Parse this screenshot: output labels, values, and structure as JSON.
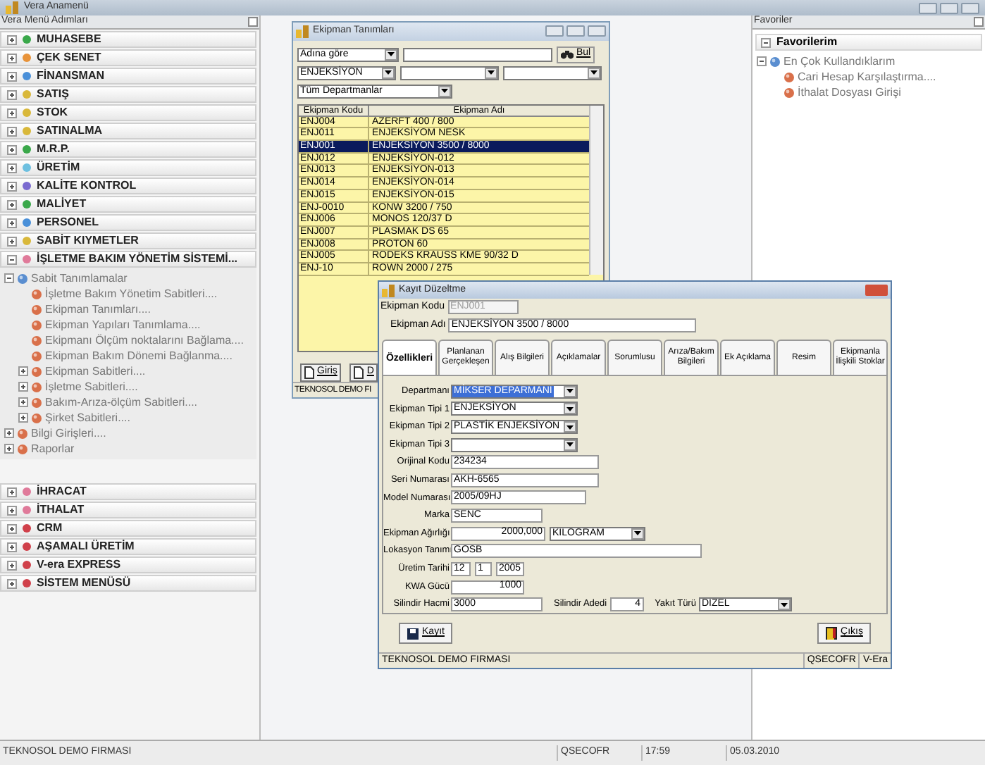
{
  "window": {
    "title": "Vera Anamenü"
  },
  "menu_panel": {
    "title": "Vera Menü Adımları",
    "items": [
      {
        "label": "MUHASEBE",
        "expanded": false,
        "color": "#3aa84a"
      },
      {
        "label": "ÇEK SENET",
        "expanded": false,
        "color": "#e8933a"
      },
      {
        "label": "FİNANSMAN",
        "expanded": false,
        "color": "#4a90d9"
      },
      {
        "label": "SATIŞ",
        "expanded": false,
        "color": "#d9b83a"
      },
      {
        "label": "STOK",
        "expanded": false,
        "color": "#d9b83a"
      },
      {
        "label": "SATINALMA",
        "expanded": false,
        "color": "#d9b83a"
      },
      {
        "label": "M.R.P.",
        "expanded": false,
        "color": "#3aa84a"
      },
      {
        "label": "ÜRETİM",
        "expanded": false,
        "color": "#6ec0e0"
      },
      {
        "label": "KALİTE KONTROL",
        "expanded": false,
        "color": "#7a6ad0"
      },
      {
        "label": "MALİYET",
        "expanded": false,
        "color": "#3aa84a"
      },
      {
        "label": "PERSONEL",
        "expanded": false,
        "color": "#4a90d9"
      },
      {
        "label": "SABİT KIYMETLER",
        "expanded": false,
        "color": "#d9b83a"
      },
      {
        "label": "İŞLETME BAKIM YÖNETİM SİSTEMİ...",
        "expanded": true,
        "color": "#e07a9a",
        "children": [
          {
            "label": "Sabit Tanımlamalar",
            "expanded": true,
            "children": [
              {
                "label": "İşletme Bakım Yönetim Sabitleri...."
              },
              {
                "label": "Ekipman Tanımları...."
              },
              {
                "label": "Ekipman Yapıları Tanımlama...."
              },
              {
                "label": "Ekipmanı Ölçüm noktalarını Bağlama...."
              },
              {
                "label": "Ekipman Bakım Dönemi Bağlanma...."
              },
              {
                "label": "Ekipman Sabitleri....",
                "expanded": false
              },
              {
                "label": "İşletme Sabitleri....",
                "expanded": false
              },
              {
                "label": "Bakım-Arıza-ölçüm Sabitleri....",
                "expanded": false
              },
              {
                "label": "Şirket Sabitleri....",
                "expanded": false
              }
            ]
          },
          {
            "label": "Bilgi Girişleri....",
            "expanded": false
          },
          {
            "label": "Raporlar",
            "expanded": false
          }
        ]
      },
      {
        "label": "İHRACAT",
        "expanded": false,
        "color": "#e07a9a"
      },
      {
        "label": "İTHALAT",
        "expanded": false,
        "color": "#e07a9a"
      },
      {
        "label": "CRM",
        "expanded": false,
        "color": "#d0404a"
      },
      {
        "label": "AŞAMALI ÜRETİM",
        "expanded": false,
        "color": "#d0404a"
      },
      {
        "label": "V-era EXPRESS",
        "expanded": false,
        "color": "#d0404a"
      },
      {
        "label": "SİSTEM MENÜSÜ",
        "expanded": false,
        "color": "#d0404a"
      }
    ]
  },
  "favorites_panel": {
    "title": "Favoriler",
    "group": "Favorilerim",
    "items": [
      {
        "label": "En Çok Kullandıklarım",
        "expanded": true,
        "children": [
          {
            "label": "Cari Hesap Karşılaştırma...."
          },
          {
            "label": "İthalat Dosyası Girişi"
          }
        ]
      }
    ]
  },
  "equipment_window": {
    "title": "Ekipman Tanımları",
    "search_by": "Adına göre",
    "search_button": "Bul",
    "type_filter": "ENJEKSİYON",
    "department": "Tüm Departmanlar",
    "columns": [
      "Ekipman Kodu",
      "Ekipman Adı"
    ],
    "rows": [
      {
        "code": "ENJ004",
        "name": "AZERFT 400 / 800",
        "selected": false
      },
      {
        "code": "ENJ011",
        "name": "ENJEKSİYOM NESK",
        "selected": false
      },
      {
        "code": "ENJ001",
        "name": "ENJEKSİYON 3500 / 8000",
        "selected": true
      },
      {
        "code": "ENJ012",
        "name": "ENJEKSİYON-012",
        "selected": false
      },
      {
        "code": "ENJ013",
        "name": "ENJEKSİYON-013",
        "selected": false
      },
      {
        "code": "ENJ014",
        "name": "ENJEKSİYON-014",
        "selected": false
      },
      {
        "code": "ENJ015",
        "name": "ENJEKSİYON-015",
        "selected": false
      },
      {
        "code": "ENJ-0010",
        "name": "KONW 3200 / 750",
        "selected": false
      },
      {
        "code": "ENJ006",
        "name": "MONOS 120/37 D",
        "selected": false
      },
      {
        "code": "ENJ007",
        "name": "PLASMAK DS 65",
        "selected": false
      },
      {
        "code": "ENJ008",
        "name": "PROTON 60",
        "selected": false
      },
      {
        "code": "ENJ005",
        "name": "RODEKS KRAUSS KME 90/32 D",
        "selected": false
      },
      {
        "code": "ENJ-10",
        "name": "ROWN 2000 / 275",
        "selected": false
      }
    ],
    "buttons": [
      "Giriş",
      "D"
    ],
    "status": "TEKNOSOL DEMO FI"
  },
  "edit_window": {
    "title": "Kayıt Düzeltme",
    "header_fields": [
      {
        "label": "Ekipman Kodu",
        "value": "ENJ001",
        "disabled": true
      },
      {
        "label": "Ekipman Adı",
        "value": "ENJEKSİYON 3500 / 8000",
        "disabled": false
      }
    ],
    "tabs": [
      {
        "label": "Özellikleri",
        "selected": true
      },
      {
        "label": "Planlanan Gerçekleşen",
        "selected": false
      },
      {
        "label": "Alış Bilgileri",
        "selected": false
      },
      {
        "label": "Açıklamalar",
        "selected": false
      },
      {
        "label": "Sorumlusu",
        "selected": false
      },
      {
        "label": "Arıza/Bakım Bilgileri",
        "selected": false
      },
      {
        "label": "Ek Açıklama",
        "selected": false
      },
      {
        "label": "Resim",
        "selected": false
      },
      {
        "label": "Ekipmanla İlişkili Stoklar",
        "selected": false
      }
    ],
    "rows": [
      {
        "label": "Departmanı",
        "fields": [
          {
            "kind": "select",
            "value": "MİKSER DEPARMANI",
            "highlighted": true
          }
        ]
      },
      {
        "label": "Ekipman Tipi 1",
        "fields": [
          {
            "kind": "select",
            "value": "ENJEKSİYON",
            "highlighted": false
          }
        ]
      },
      {
        "label": "Ekipman Tipi 2",
        "fields": [
          {
            "kind": "select",
            "value": "PLASTİK ENJEKSİYON",
            "highlighted": false
          }
        ]
      },
      {
        "label": "Ekipman Tipi 3",
        "fields": [
          {
            "kind": "select",
            "highlighted": false
          }
        ]
      },
      {
        "label": "Orijinal Kodu",
        "fields": [
          {
            "kind": "text",
            "value": "234234",
            "highlighted": false
          }
        ]
      },
      {
        "label": "Seri Numarası",
        "fields": [
          {
            "kind": "text",
            "value": "AKH-6565",
            "highlighted": false
          }
        ]
      },
      {
        "label": "Model Numarası",
        "fields": [
          {
            "kind": "text",
            "value": "2005/09HJ",
            "highlighted": false
          }
        ]
      },
      {
        "label": "Marka",
        "fields": [
          {
            "kind": "text",
            "value": "SENC",
            "highlighted": false
          }
        ]
      },
      {
        "label": "Ekipman Ağırlığı",
        "fields": [
          {
            "kind": "number",
            "value": "2000,000",
            "highlighted": false
          },
          {
            "kind": "select",
            "value": "KILOGRAM",
            "highlighted": false
          }
        ]
      },
      {
        "label": "Lokasyon Tanımı",
        "fields": [
          {
            "kind": "text",
            "value": "GOSB",
            "highlighted": false
          }
        ]
      },
      {
        "label": "Üretim Tarihi",
        "fields": [
          {
            "kind": "text",
            "value": "12",
            "highlighted": false
          },
          {
            "kind": "text",
            "value": "1",
            "highlighted": false
          },
          {
            "kind": "text",
            "value": "2005",
            "highlighted": false
          }
        ]
      },
      {
        "label": "KWA Gücü",
        "fields": [
          {
            "kind": "number",
            "value": "1000",
            "highlighted": false
          }
        ]
      },
      {
        "label": "Silindir Hacmi",
        "fields": [
          {
            "kind": "text",
            "value": "3000",
            "highlighted": false
          },
          {
            "kind": "number",
            "label": "Silindir Adedi",
            "value": "4",
            "highlighted": false
          },
          {
            "kind": "select",
            "label": "Yakıt Türü",
            "value": "DIZEL",
            "highlighted": false
          }
        ]
      }
    ],
    "buttons": [
      {
        "kind": "save",
        "label": "Kayıt"
      },
      {
        "kind": "exit",
        "label": "Çıkış"
      }
    ],
    "status": [
      "TEKNOSOL DEMO FIRMASI",
      "QSECOFR",
      "V-Era"
    ]
  },
  "status_bar": [
    "TEKNOSOL DEMO FIRMASI",
    "QSECOFR",
    "17:59",
    "05.03.2010"
  ]
}
